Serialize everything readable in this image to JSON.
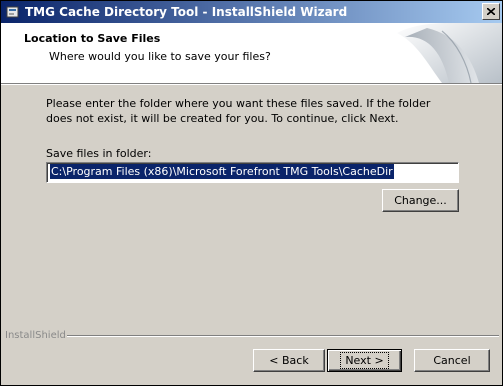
{
  "window": {
    "title": "TMG Cache Directory Tool - InstallShield Wizard"
  },
  "header": {
    "title": "Location to Save Files",
    "subtitle": "Where would you like to save your files?"
  },
  "main": {
    "instructions": "Please enter the folder where you want these files saved.  If the folder does not exist, it will be created for you.   To continue, click Next.",
    "field_label": "Save files in folder:",
    "folder_path": "C:\\Program Files (x86)\\Microsoft Forefront TMG Tools\\CacheDir",
    "change_label": "Change..."
  },
  "footer": {
    "brand": "InstallShield",
    "back_label": "< Back",
    "next_label": "Next >",
    "cancel_label": "Cancel"
  },
  "colors": {
    "titlebar_start": "#0a246a",
    "titlebar_end": "#a6caf0",
    "selection": "#0a246a",
    "dialog_face": "#d4d0c8"
  }
}
